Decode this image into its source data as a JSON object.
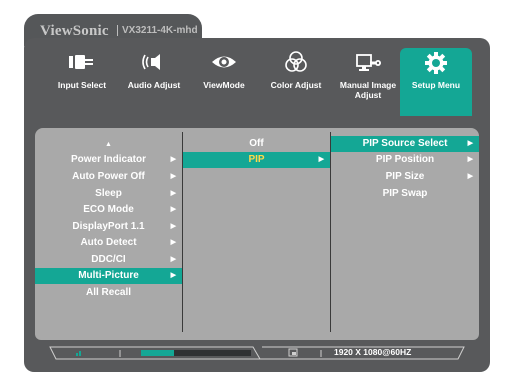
{
  "header": {
    "brand": "ViewSonic",
    "model": "VX3211-4K-mhd"
  },
  "tabs": [
    {
      "label": "Input Select",
      "icon": "input-select-icon"
    },
    {
      "label": "Audio Adjust",
      "icon": "speaker-icon"
    },
    {
      "label": "ViewMode",
      "icon": "eye-icon"
    },
    {
      "label": "Color Adjust",
      "icon": "color-circles-icon"
    },
    {
      "label": "Manual Image Adjust",
      "icon": "image-adjust-icon"
    },
    {
      "label": "Setup Menu",
      "icon": "gear-icon"
    }
  ],
  "menu_col1": {
    "up_arrow": "▲",
    "items": [
      "Power Indicator",
      "Auto Power Off",
      "Sleep",
      "ECO Mode",
      "DisplayPort 1.1",
      "Auto Detect",
      "DDC/CI",
      "Multi-Picture",
      "All Recall"
    ],
    "selected": "Multi-Picture"
  },
  "menu_col2": {
    "items": [
      "Off",
      "PIP"
    ],
    "selected": "PIP"
  },
  "menu_col3": {
    "items": [
      "PIP Source Select",
      "PIP Position",
      "PIP Size",
      "PIP Swap"
    ],
    "selected": "PIP Source Select"
  },
  "status": {
    "resolution": "1920 X 1080@60HZ",
    "bar_level": 0.3
  },
  "colors": {
    "accent": "#14a795",
    "frame": "#58595b",
    "panel": "#a9a9a9",
    "highlight": "#ffd84a"
  }
}
